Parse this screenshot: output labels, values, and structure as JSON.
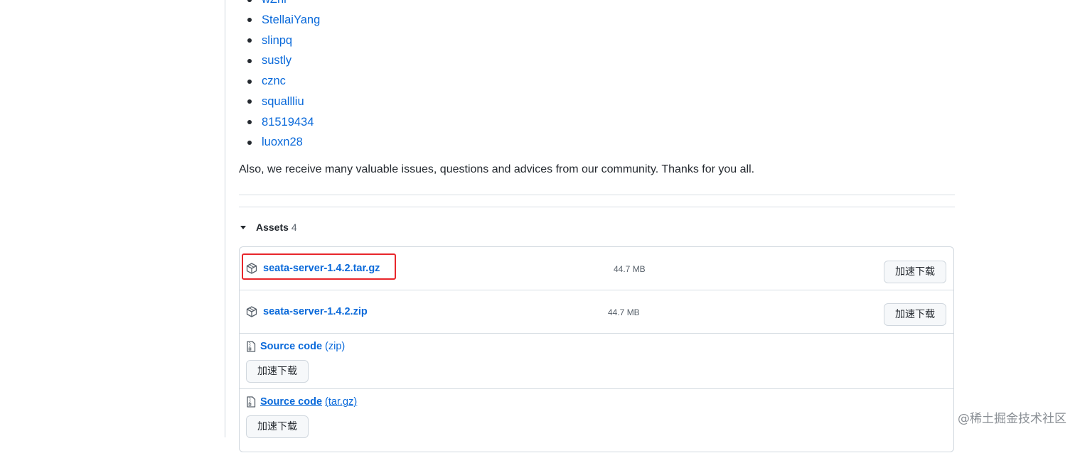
{
  "contributors": [
    "wZhl",
    "StellaiYang",
    "slinpq",
    "sustly",
    "cznc",
    "squallliu",
    "81519434",
    "luoxn28"
  ],
  "thanks_text": "Also, we receive many valuable issues, questions and advices from our community. Thanks for you all.",
  "assets": {
    "title": "Assets",
    "count": "4",
    "files": [
      {
        "name": "seata-server-1.4.2.tar.gz",
        "size": "44.7 MB",
        "button": "加速下载"
      },
      {
        "name": "seata-server-1.4.2.zip",
        "size": "44.7 MB",
        "button": "加速下载"
      }
    ],
    "sources": [
      {
        "name": "Source code",
        "type": "(zip)",
        "button": "加速下载"
      },
      {
        "name": "Source code",
        "type": "(tar.gz)",
        "button": "加速下载"
      }
    ]
  },
  "watermark": "@稀土掘金技术社区",
  "colors": {
    "link": "#0969da",
    "highlight": "#e8262b"
  },
  "icons": {
    "package": "package-icon",
    "file_zip": "file-zip-icon",
    "caret": "caret-down-icon"
  }
}
